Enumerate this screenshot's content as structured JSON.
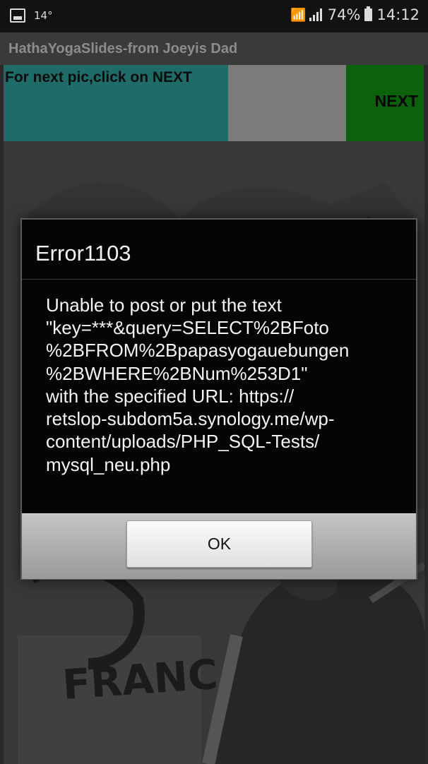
{
  "status_bar": {
    "temperature": "14°",
    "battery": "74%",
    "time": "14:12",
    "icons": [
      "gallery-icon",
      "wifi-icon",
      "signal-icon",
      "battery-icon"
    ]
  },
  "app": {
    "title": "HathaYogaSlides-from Joeyis Dad"
  },
  "banner": {
    "hint": "For next pic,click on NEXT",
    "next_label": "NEXT",
    "colors": {
      "hint_bg": "#1e6b68",
      "next_bg": "#0b620b"
    }
  },
  "dialog": {
    "title": "Error1103",
    "message_lines": [
      "Unable to post or put the text",
      "\"key=***&query=SELECT%2BFoto",
      "%2BFROM%2Bpapasyogauebungen",
      "%2BWHERE%2BNum%253D1\"",
      "with the specified URL: https://",
      "retslop-subdom5a.synology.me/wp-",
      "content/uploads/PHP_SQL-Tests/",
      "mysql_neu.php"
    ],
    "ok_label": "OK"
  }
}
